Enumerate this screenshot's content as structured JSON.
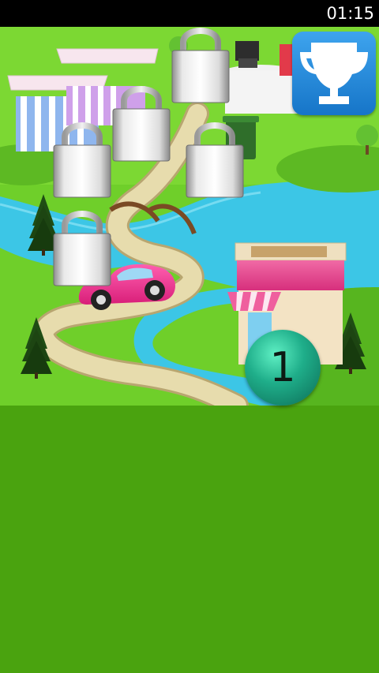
{
  "status_bar": {
    "time": "01:15"
  },
  "map": {
    "locked_levels": [
      {
        "name": "market-stall-lock",
        "state": "locked"
      },
      {
        "name": "shop-counter-lock",
        "state": "locked"
      },
      {
        "name": "left-lock-1",
        "state": "locked"
      },
      {
        "name": "left-lock-2",
        "state": "locked"
      },
      {
        "name": "center-lock",
        "state": "locked"
      },
      {
        "name": "bottom-lock",
        "state": "locked"
      }
    ],
    "current_level": "1"
  },
  "trophy_button": {
    "icon": "trophy-icon"
  },
  "colors": {
    "grass": "#4aa30f",
    "river": "#3cc6e6",
    "car": "#ee2c8a",
    "trophy_bg": "#1f86d8"
  }
}
